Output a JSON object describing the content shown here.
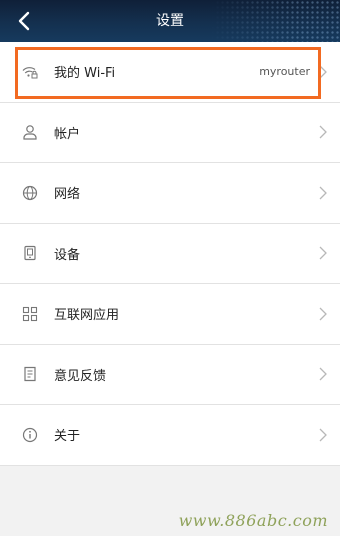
{
  "header": {
    "title": "设置",
    "back_icon": "chevron-left-icon"
  },
  "menu": {
    "items": [
      {
        "id": "wifi",
        "label": "我的 Wi-Fi",
        "value": "myrouter",
        "icon": "wifi-lock-icon",
        "highlighted": true
      },
      {
        "id": "account",
        "label": "帐户",
        "icon": "user-icon"
      },
      {
        "id": "network",
        "label": "网络",
        "icon": "globe-icon"
      },
      {
        "id": "devices",
        "label": "设备",
        "icon": "device-icon"
      },
      {
        "id": "internet-apps",
        "label": "互联网应用",
        "icon": "grid-icon"
      },
      {
        "id": "feedback",
        "label": "意见反馈",
        "icon": "feedback-icon"
      },
      {
        "id": "about",
        "label": "关于",
        "icon": "info-icon"
      }
    ]
  },
  "watermark": "www.886abc.com",
  "colors": {
    "header_bg": "#14304f",
    "highlight_border": "#f26a21",
    "watermark": "#8fa25a"
  }
}
